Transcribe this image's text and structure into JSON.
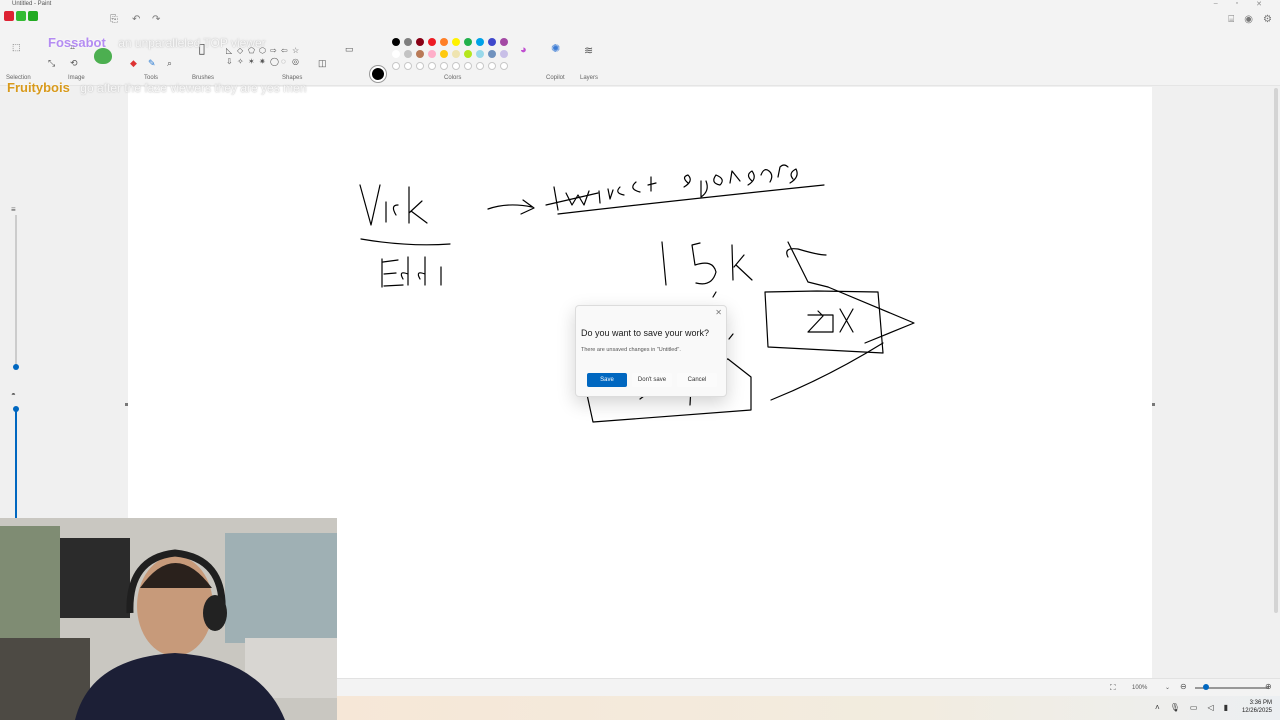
{
  "window": {
    "title": "Untitled - Paint"
  },
  "ribbon": {
    "groups": [
      {
        "id": "selection",
        "label": "Selection"
      },
      {
        "id": "image",
        "label": "Image"
      },
      {
        "id": "tools",
        "label": "Tools"
      },
      {
        "id": "brushes",
        "label": "Brushes"
      },
      {
        "id": "shapes",
        "label": "Shapes"
      },
      {
        "id": "colors",
        "label": "Colors"
      },
      {
        "id": "copilot",
        "label": "Copilot"
      },
      {
        "id": "layers",
        "label": "Layers"
      }
    ],
    "palette_row1": [
      "#000000",
      "#7f7f7f",
      "#880015",
      "#ed1c24",
      "#ff7f27",
      "#fff200",
      "#22b14c",
      "#00a2e8",
      "#3f48cc",
      "#a349a4"
    ],
    "palette_row2": [
      "#ffffff",
      "#c3c3c3",
      "#b97a57",
      "#ffaec9",
      "#ffc90e",
      "#efe4b0",
      "#b5e61d",
      "#99d9ea",
      "#7092be",
      "#c8bfe7"
    ]
  },
  "chat": {
    "lines": [
      {
        "name": "Fossabot",
        "name_color": "#b48cf2",
        "message": "an unparalleled TOP viewer"
      },
      {
        "name": "Fruitybois",
        "name_color": "#d89a1c",
        "message": "go after the faze viewers they are yes men"
      }
    ]
  },
  "drawing": {
    "labels": [
      "Vick",
      "Eddi",
      "twitch sponsors",
      "15k",
      "3X"
    ]
  },
  "dialog": {
    "title": "Do you want to save your work?",
    "message": "There are unsaved changes in \"Untitled\".",
    "save_label": "Save",
    "dont_save_label": "Don't save",
    "cancel_label": "Cancel"
  },
  "status": {
    "zoom": "100%"
  },
  "taskbar": {
    "time": "3:36 PM",
    "date": "12/26/2025"
  }
}
